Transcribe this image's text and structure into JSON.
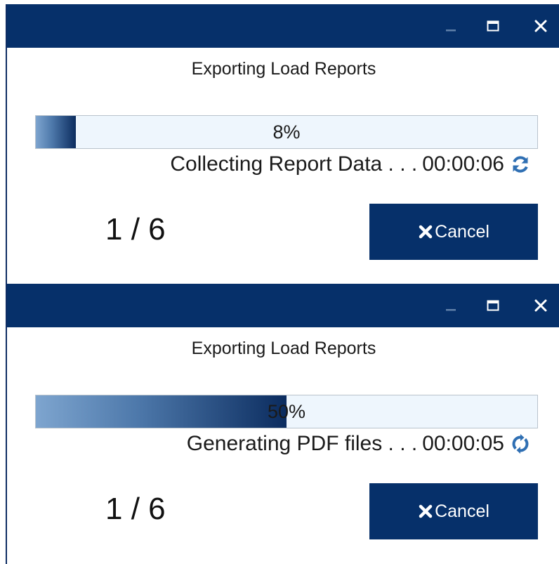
{
  "dialogs": [
    {
      "title": "Exporting Load Reports",
      "progress_value": 8,
      "progress_text": "8%",
      "status_text": "Collecting Report Data . . .",
      "elapsed": "00:00:06",
      "refresh_icon": "refresh-icon",
      "counter": "1 / 6",
      "cancel_label": "Cancel",
      "cancel_icon": "close-icon"
    },
    {
      "title": "Exporting Load Reports",
      "progress_value": 50,
      "progress_text": "50%",
      "status_text": "Generating PDF files . . .",
      "elapsed": "00:00:05",
      "refresh_icon": "sync-icon",
      "counter": "1 / 6",
      "cancel_label": "Cancel",
      "cancel_icon": "close-icon"
    }
  ],
  "window_controls": {
    "minimize_icon": "minimize-icon",
    "maximize_icon": "maximize-icon",
    "close_icon": "close-icon"
  },
  "colors": {
    "titlebar": "#06306a",
    "button": "#06306a",
    "progress_track": "#eef6fd",
    "progress_fill_start": "#7ea5cf",
    "progress_fill_end": "#0b2c5f",
    "icon_blue": "#2f6fb3"
  }
}
